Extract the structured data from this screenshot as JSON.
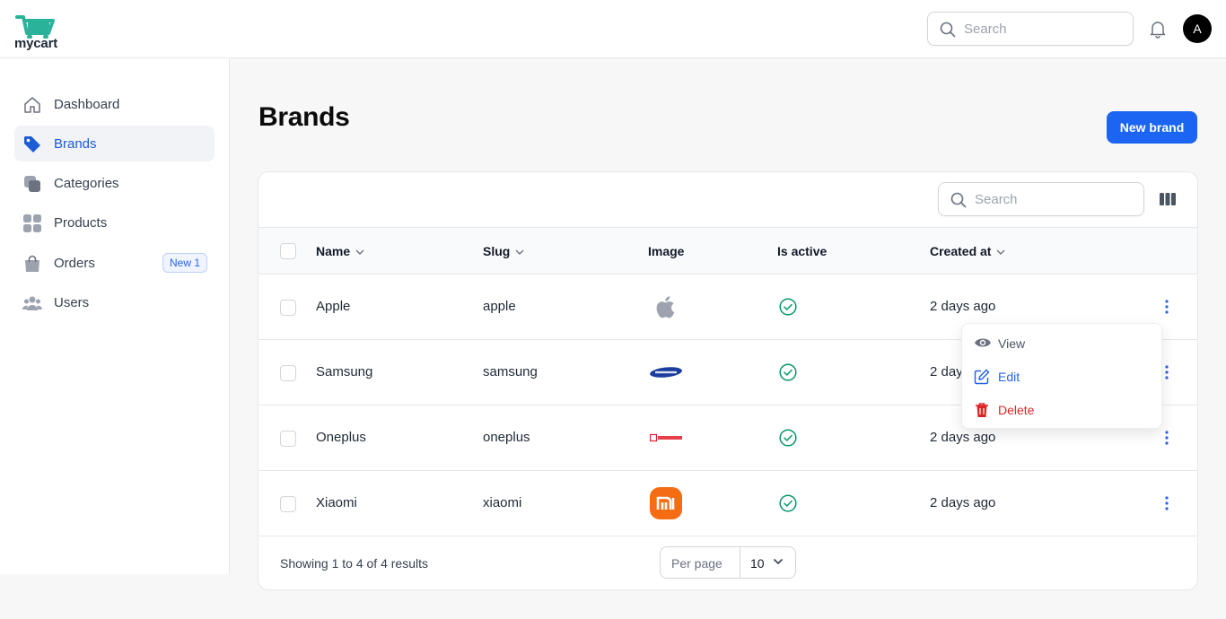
{
  "app": {
    "logo_text": "mycart"
  },
  "header": {
    "search_placeholder": "Search",
    "avatar_initial": "A"
  },
  "sidebar": {
    "items": [
      {
        "label": "Dashboard",
        "icon": "home-icon"
      },
      {
        "label": "Brands",
        "icon": "tag-icon",
        "active": true
      },
      {
        "label": "Categories",
        "icon": "layers-icon"
      },
      {
        "label": "Products",
        "icon": "grid-icon"
      },
      {
        "label": "Orders",
        "icon": "shopping-bag-icon",
        "badge": "New 1"
      },
      {
        "label": "Users",
        "icon": "users-icon"
      }
    ]
  },
  "page": {
    "title": "Brands",
    "new_button": "New brand"
  },
  "table": {
    "search_placeholder": "Search",
    "columns": [
      "Name",
      "Slug",
      "Image",
      "Is active",
      "Created at"
    ],
    "rows": [
      {
        "name": "Apple",
        "slug": "apple",
        "image": "apple-logo",
        "active": true,
        "created": "2 days ago"
      },
      {
        "name": "Samsung",
        "slug": "samsung",
        "image": "samsung-logo",
        "active": true,
        "created": "2 days ago"
      },
      {
        "name": "Oneplus",
        "slug": "oneplus",
        "image": "oneplus-logo",
        "active": true,
        "created": "2 days ago"
      },
      {
        "name": "Xiaomi",
        "slug": "xiaomi",
        "image": "xiaomi-logo",
        "active": true,
        "created": "2 days ago"
      }
    ],
    "footer": {
      "showing": "Showing 1 to 4 of 4 results",
      "per_page_label": "Per page",
      "per_page_value": "10"
    }
  },
  "row_menu": {
    "view": "View",
    "edit": "Edit",
    "delete": "Delete"
  },
  "colors": {
    "primary": "#1c64f2",
    "success": "#059669",
    "danger": "#dc2626",
    "logo_teal": "#2ab39a"
  }
}
